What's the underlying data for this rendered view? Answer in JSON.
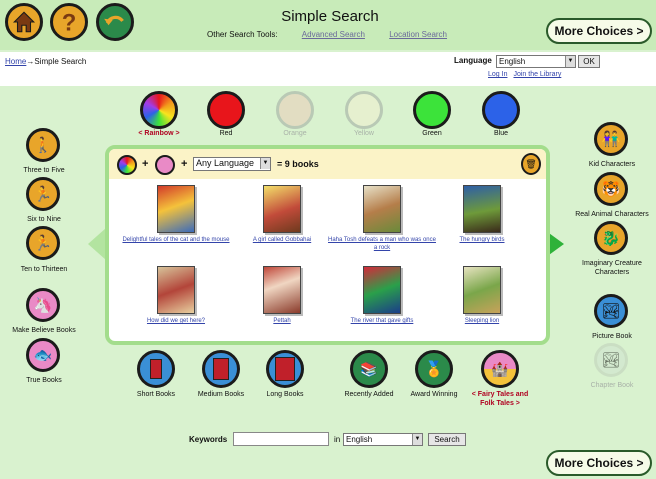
{
  "header": {
    "title": "Simple Search",
    "other_tools_label": "Other Search Tools:",
    "advanced_search": "Advanced Search",
    "location_search": "Location Search",
    "more_choices": "More Choices >"
  },
  "breadcrumb": {
    "home": "Home",
    "arrow": "→",
    "current": "Simple Search"
  },
  "language": {
    "label": "Language",
    "value": "English",
    "ok": "OK"
  },
  "account": {
    "login": "Log In",
    "join": "Join the Library"
  },
  "colors": [
    {
      "label": "< Rainbow >",
      "color": "rainbow",
      "selected": true
    },
    {
      "label": "Red",
      "color": "#e8151b"
    },
    {
      "label": "Orange",
      "color": "#e2ddc2",
      "faded": true
    },
    {
      "label": "Yellow",
      "color": "#e6f0cf",
      "faded": true
    },
    {
      "label": "Green",
      "color": "#3ce33a"
    },
    {
      "label": "Blue",
      "color": "#2c62e8"
    }
  ],
  "age_groups": [
    {
      "label": "Three to Five",
      "icon": "toddler-icon"
    },
    {
      "label": "Six to Nine",
      "icon": "child-running-icon"
    },
    {
      "label": "Ten to Thirteen",
      "icon": "runner-icon"
    }
  ],
  "book_types": [
    {
      "label": "Make Believe Books",
      "icon": "unicorn-icon"
    },
    {
      "label": "True Books",
      "icon": "fish-icon"
    }
  ],
  "characters": [
    {
      "label": "Kid Characters",
      "icon": "kids-icon"
    },
    {
      "label": "Real Animal Characters",
      "icon": "tiger-icon"
    },
    {
      "label": "Imaginary Creature Characters",
      "icon": "dragon-icon"
    },
    {
      "label": "Picture Book",
      "icon": "picture-icon"
    },
    {
      "label": "Chapter Book",
      "icon": "chapter-icon",
      "faded": true
    }
  ],
  "results": {
    "language_filter": "Any Language",
    "count": "= 9 books",
    "books": [
      {
        "title": "Delightful tales of the cat and the mouse"
      },
      {
        "title": "A girl called Gobbahai"
      },
      {
        "title": "Haha Tosh defeats a man who was once a rock"
      },
      {
        "title": "The hungry birds"
      },
      {
        "title": "How did we get here?"
      },
      {
        "title": "Pettah"
      },
      {
        "title": "The river that gave gifts"
      },
      {
        "title": "Sleeping lion"
      }
    ]
  },
  "bottom": [
    {
      "label": "Short Books",
      "icon": "short-book-icon"
    },
    {
      "label": "Medium Books",
      "icon": "medium-book-icon"
    },
    {
      "label": "Long Books",
      "icon": "long-book-icon"
    },
    {
      "label": "Recently Added",
      "icon": "new-books-icon"
    },
    {
      "label": "Award Winning",
      "icon": "medal-icon"
    },
    {
      "label": "< Fairy Tales and Folk Tales >",
      "icon": "fairy-tales-icon",
      "selected": true
    }
  ],
  "keywords": {
    "label": "Keywords",
    "in": "in",
    "language": "English",
    "search": "Search"
  },
  "more_choices_bottom": "More Choices >"
}
